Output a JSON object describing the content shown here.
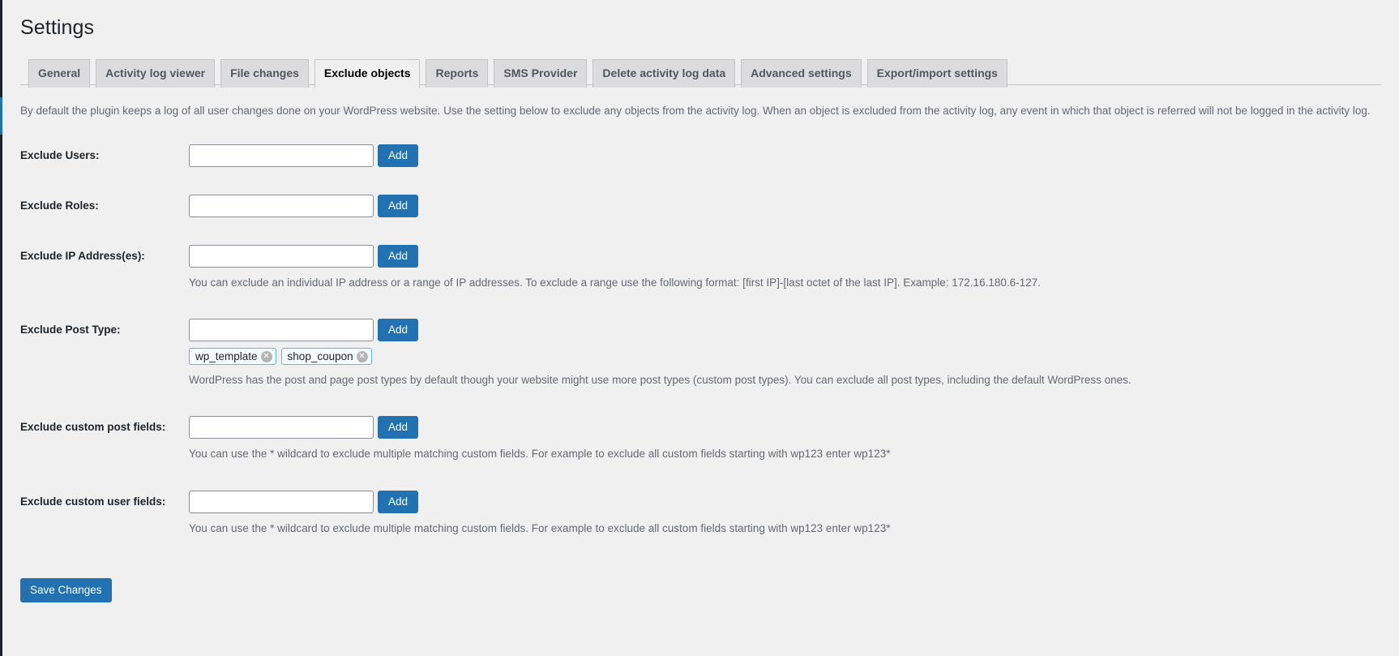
{
  "page": {
    "title": "Settings",
    "intro": "By default the plugin keeps a log of all user changes done on your WordPress website. Use the setting below to exclude any objects from the activity log. When an object is excluded from the activity log, any event in which that object is referred will not be logged in the activity log."
  },
  "tabs": [
    {
      "label": "General",
      "active": false
    },
    {
      "label": "Activity log viewer",
      "active": false
    },
    {
      "label": "File changes",
      "active": false
    },
    {
      "label": "Exclude objects",
      "active": true
    },
    {
      "label": "Reports",
      "active": false
    },
    {
      "label": "SMS Provider",
      "active": false
    },
    {
      "label": "Delete activity log data",
      "active": false
    },
    {
      "label": "Advanced settings",
      "active": false
    },
    {
      "label": "Export/import settings",
      "active": false
    }
  ],
  "fields": {
    "exclude_users": {
      "label": "Exclude Users:",
      "value": "",
      "placeholder": "",
      "add_label": "Add"
    },
    "exclude_roles": {
      "label": "Exclude Roles:",
      "value": "",
      "placeholder": "",
      "add_label": "Add"
    },
    "exclude_ip": {
      "label": "Exclude IP Address(es):",
      "value": "",
      "placeholder": "",
      "add_label": "Add",
      "description": "You can exclude an individual IP address or a range of IP addresses. To exclude a range use the following format: [first IP]-[last octet of the last IP]. Example: 172.16.180.6-127."
    },
    "exclude_post_type": {
      "label": "Exclude Post Type:",
      "value": "",
      "placeholder": "",
      "add_label": "Add",
      "description": "WordPress has the post and page post types by default though your website might use more post types (custom post types). You can exclude all post types, including the default WordPress ones.",
      "chips": [
        {
          "label": "wp_template",
          "remove_label": "✕"
        },
        {
          "label": "shop_coupon",
          "remove_label": "✕"
        }
      ]
    },
    "exclude_custom_post_fields": {
      "label": "Exclude custom post fields:",
      "value": "",
      "placeholder": "",
      "add_label": "Add",
      "description": "You can use the * wildcard to exclude multiple matching custom fields. For example to exclude all custom fields starting with wp123 enter wp123*"
    },
    "exclude_custom_user_fields": {
      "label": "Exclude custom user fields:",
      "value": "",
      "placeholder": "",
      "add_label": "Add",
      "description": "You can use the * wildcard to exclude multiple matching custom fields. For example to exclude all custom fields starting with wp123 enter wp123*"
    }
  },
  "submit": {
    "save_label": "Save Changes"
  },
  "colors": {
    "accent": "#2271b1",
    "page_bg": "#f0f0f1",
    "tab_bg": "#dcdcde",
    "border": "#c3c4c7",
    "chip_border": "#5bb8e8"
  }
}
